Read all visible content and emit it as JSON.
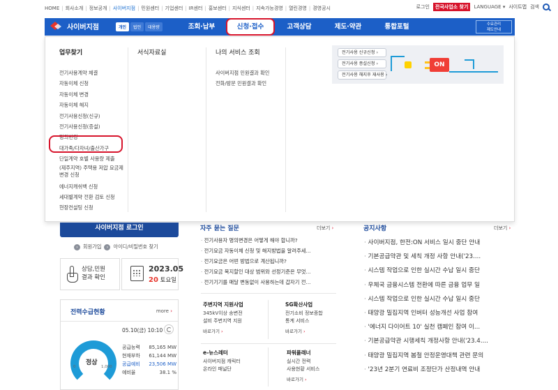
{
  "topbar": {
    "links": [
      "HOME",
      "회사소개",
      "정보공개",
      "사이버지점",
      "민원센터",
      "기업센터",
      "IR센터",
      "홍보센터",
      "지식센터",
      "지속가능경영",
      "열린경영",
      "경영공시"
    ],
    "active_index": 3,
    "login": "로그인",
    "promo": "전국사업소 찾기",
    "language": "LANGUAGE ▾",
    "sitemap": "사이트맵",
    "search": "검색"
  },
  "gnb": {
    "logo_text": "사이버지점",
    "modes": [
      "개인",
      "법인",
      "대용량"
    ],
    "active_mode": 0,
    "menu": [
      "조회·납부",
      "신청·접수",
      "고객상담",
      "제도·약관",
      "통합포털"
    ],
    "active_menu": 1,
    "demand_button": "수요관리\n제도안내"
  },
  "mega": {
    "col1": {
      "title": "업무찾기",
      "items": [
        "전기사용계약 체결",
        "자동이체 신청",
        "자동이체 변경",
        "자동이체 해지",
        "전기사용신청(신규)",
        "전기사용신청(증설)",
        "명의변경",
        "대가족/다자녀/출산가구",
        "단일계약 호별 사용량 제출",
        "(제주지역) 주택용 저압 요금제 변경 신청",
        "에너지캐쉬백 신청",
        "세대별계약 전환 검토 신청",
        "현장컨설팅 신청"
      ]
    },
    "col2": {
      "title": "서식자료실"
    },
    "col3": {
      "title": "나의 서비스 조회",
      "items": [
        "사이버지점 민원결과 확인",
        "전화/방문 민원결과 확인"
      ]
    },
    "banner": {
      "buttons": [
        "전기사용 신규신청 ›",
        "전기사용 증설신청 ›",
        "전기사용 해지후 재사용 ›"
      ],
      "socket_text": "ON"
    }
  },
  "main": {
    "login_button": "사이버지점 로그인",
    "member_join": "회원가입",
    "id_find": "아이디/비밀번호 찾기",
    "status_box": "상담,민원\n결과 확인",
    "date": {
      "ym": "2023.05",
      "day": "20",
      "weekday": "토요일"
    },
    "power": {
      "title": "전력수급현황",
      "more": "more",
      "time": "05.10(금) 10:10",
      "gauge_label": "정상",
      "gauge_min": "0",
      "gauge_max": "1,000",
      "rows": [
        {
          "label": "공급능력",
          "value": "85,165 MW"
        },
        {
          "label": "현재부하",
          "value": "61,144 MW"
        },
        {
          "label": "공급예비",
          "value": "23,506 MW"
        },
        {
          "label": "예비율",
          "value": "38.1 %"
        }
      ],
      "highlight_row": 2
    },
    "faq": {
      "title": "자주 묻는 질문",
      "more": "더보기",
      "items": [
        "전기사용자 명의변경은 어떻게 해야 합니까?",
        "전기요금 자동이체 신청 및 해지방법을 알려주세...",
        "전기요금은 어떤 방법으로 계산됩니까?",
        "전기요금 복지할인 대상 범위와 선정기준은 무엇...",
        "전기기기를 매달 변동없이 사용하는데 갑자기 전..."
      ]
    },
    "services": [
      {
        "title": "주변지역 지원사업",
        "desc": "345kV이상 송변전\n설비 주변지역 지원",
        "go": "바로가기"
      },
      {
        "title": "SG확산사업",
        "desc": "전기소비 정보종합\n통계 서비스",
        "go": "바로가기"
      },
      {
        "title": "e-뉴스레터",
        "desc": "사이버지점 캐릭터\n온라인 패널단",
        "go": ""
      },
      {
        "title": "파워플래너",
        "desc": "실시간 전력\n사용현황 서비스",
        "go": "바로가기"
      }
    ],
    "notice": {
      "title": "공지사항",
      "more": "더보기",
      "items": [
        "사이버지점, 한전:ON 서비스 일시 중단 안내",
        "기본공급약관 및 세칙 개정 사항 안내('23....",
        "시스템 작업으로 인한 실시간 수납 일시 중단",
        "우체국 금융시스템 전환에 따른 금융 업무 일",
        "시스템 작업으로 인한 실시간 수납 일시 중단",
        "태양광 밀집지역 인버터 성능개선 사업 참여",
        "'에너지 다이어트 10' 실천 캠페인 참여 이...",
        "기본공급약관 시행세칙 개정사항 안내('23.4....",
        "태양광 밀집지역 봄철 안정운영대책 관련 문의",
        "'23년 2분기 연료비 조정단가 산정내역 안내"
      ]
    }
  }
}
